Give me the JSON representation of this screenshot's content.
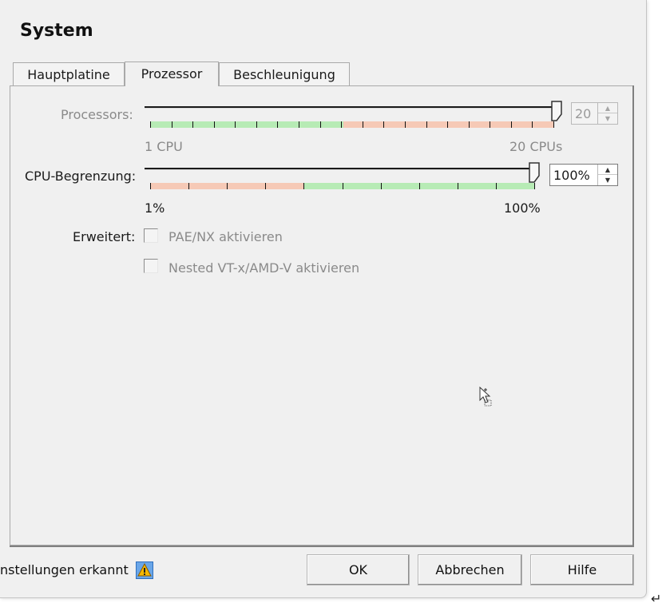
{
  "page": {
    "title": "System"
  },
  "tabs": [
    {
      "label": "Hauptplatine",
      "active": false
    },
    {
      "label": "Prozessor",
      "active": true
    },
    {
      "label": "Beschleunigung",
      "active": false
    }
  ],
  "processors": {
    "label": "Processors:",
    "value": "20",
    "min_label": "1 CPU",
    "max_label": "20 CPUs",
    "min": 1,
    "max": 20,
    "current": 20,
    "enabled": false
  },
  "cpu_limit": {
    "label": "CPU-Begrenzung:",
    "value": "100%",
    "min_label": "1%",
    "max_label": "100%",
    "min": 1,
    "max": 100,
    "current": 100,
    "enabled": true
  },
  "extended": {
    "label": "Erweitert:",
    "options": [
      {
        "label": "PAE/NX aktivieren",
        "checked": false,
        "enabled": false
      },
      {
        "label": "Nested VT-x/AMD-V aktivieren",
        "checked": false,
        "enabled": false
      }
    ]
  },
  "footer": {
    "status_text": "nstellungen erkannt",
    "ok_label": "OK",
    "cancel_label": "Abbrechen",
    "help_label": "Hilfe"
  },
  "colors": {
    "zone_green": "#b7ebb5",
    "zone_red": "#f6c9b6",
    "warning": "#f5b800"
  },
  "icons": {
    "warning": "warning-icon",
    "cursor": "mouse-pointer-icon"
  }
}
